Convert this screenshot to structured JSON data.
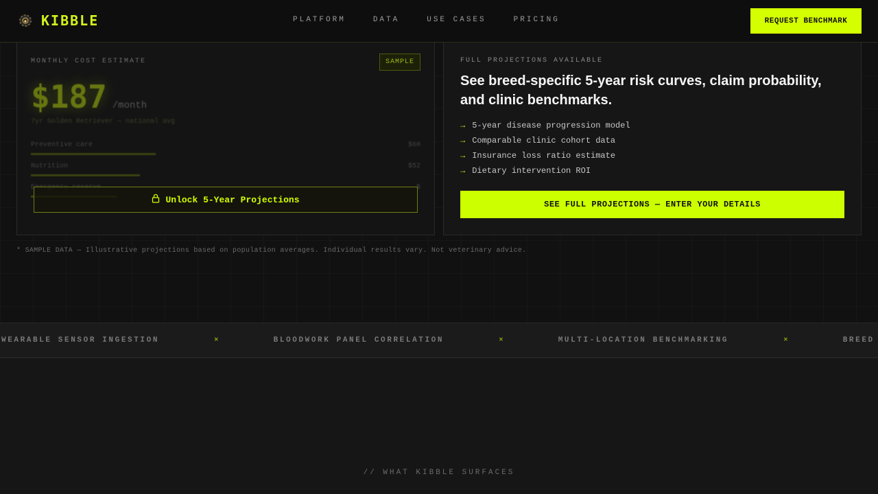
{
  "brand": {
    "name": "KIBBLE",
    "icon": "gear-paw-icon",
    "accent": "#d4ff00"
  },
  "nav": {
    "items": [
      {
        "label": "PLATFORM"
      },
      {
        "label": "DATA"
      },
      {
        "label": "USE CASES"
      },
      {
        "label": "PRICING"
      }
    ],
    "cta_label": "REQUEST BENCHMARK"
  },
  "estimate": {
    "eyebrow": "MONTHLY COST ESTIMATE",
    "badge": "SAMPLE",
    "price": "$187",
    "price_unit": "/month",
    "subtitle": "7yr Golden Retriever — national avg",
    "bars": [
      {
        "label": "Preventive care",
        "value": "$60",
        "fraction": 0.32
      },
      {
        "label": "Nutrition",
        "value": "$52",
        "fraction": 0.28
      },
      {
        "label": "Emergency reserve",
        "value": "$",
        "fraction": 0.22
      }
    ],
    "unlock_label": "Unlock 5-Year Projections"
  },
  "projections": {
    "eyebrow": "FULL PROJECTIONS AVAILABLE",
    "headline": "See breed-specific 5-year risk curves, claim probability, and clinic benchmarks.",
    "features": [
      "5-year disease progression model",
      "Comparable clinic cohort data",
      "Insurance loss ratio estimate",
      "Dietary intervention ROI"
    ],
    "cta_label": "SEE FULL PROJECTIONS — ENTER YOUR DETAILS"
  },
  "disclaimer": "* SAMPLE DATA — Illustrative projections based on population averages. Individual results vary. Not veterinary advice.",
  "ticker": {
    "items": [
      "WEARABLE SENSOR INGESTION",
      "BLOODWORK PANEL CORRELATION",
      "MULTI-LOCATION BENCHMARKING",
      "BREED RISK"
    ],
    "separator": "×"
  },
  "section_label": "// WHAT KIBBLE SURFACES"
}
